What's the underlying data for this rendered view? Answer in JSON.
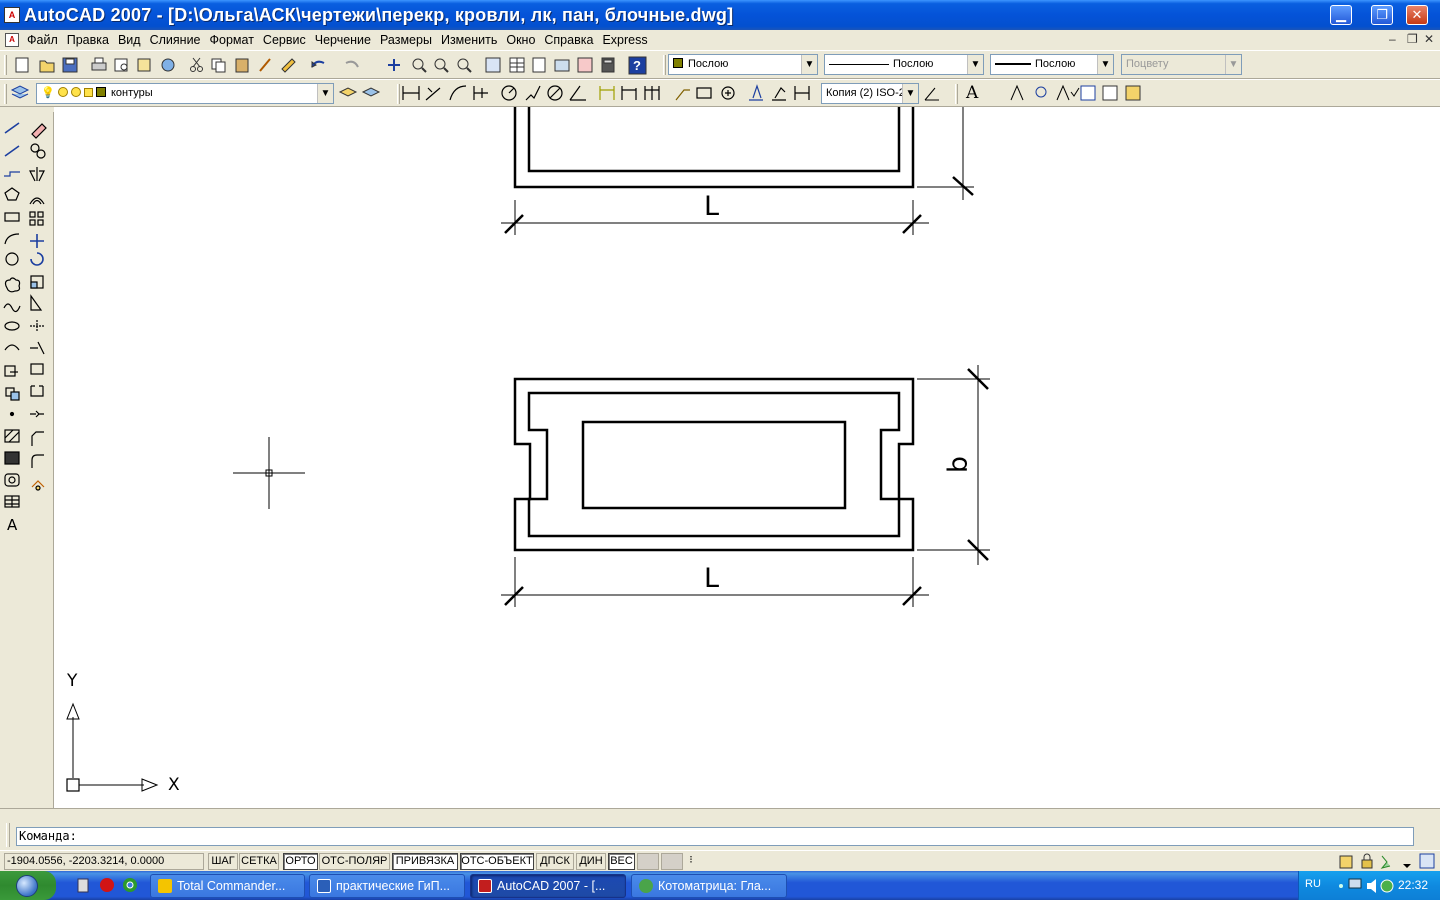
{
  "window": {
    "title": "AutoCAD 2007 - [D:\\Ольга\\АСК\\чертежи\\перекр, кровли, лк, пан, блочные.dwg]",
    "controls": {
      "minimize": "▁",
      "restore": "❐",
      "close": "✕"
    }
  },
  "menu": {
    "items": [
      "Файл",
      "Правка",
      "Вид",
      "Слияние",
      "Формат",
      "Сервис",
      "Черчение",
      "Размеры",
      "Изменить",
      "Окно",
      "Справка",
      "Express"
    ],
    "doc_controls": {
      "minimize": "–",
      "restore": "❐",
      "close": "✕"
    }
  },
  "properties_toolbar": {
    "color": "Послою",
    "linetype": "Послою",
    "lineweight": "Послою",
    "plotstyle": "Поцвету"
  },
  "layers_toolbar": {
    "current_layer": "контуры",
    "dim_style": "Копия (2) ISO-2"
  },
  "text_toolbar": {
    "text_tool_label": "A"
  },
  "drawing": {
    "dim_label_length_top": "L",
    "dim_label_length_bottom": "L",
    "dim_label_width": "b",
    "ucs_y": "Y",
    "ucs_x": "X"
  },
  "command": {
    "prompt": "Команда:"
  },
  "status": {
    "coordinates": "-1904.0556, -2203.3214, 0.0000",
    "buttons": [
      {
        "label": "ШАГ",
        "on": false
      },
      {
        "label": "СЕТКА",
        "on": false
      },
      {
        "label": "ОРТО",
        "on": true
      },
      {
        "label": "ОТС-ПОЛЯР",
        "on": false
      },
      {
        "label": "ПРИВЯЗКА",
        "on": true
      },
      {
        "label": "ОТС-ОБЪЕКТ",
        "on": true
      },
      {
        "label": "ДПСК",
        "on": false
      },
      {
        "label": "ДИН",
        "on": false
      },
      {
        "label": "ВЕС",
        "on": true
      }
    ]
  },
  "taskbar": {
    "tasks": [
      {
        "label": "Total Commander...",
        "active": false,
        "color": "#f4c400"
      },
      {
        "label": "практические ГиП...",
        "active": false,
        "color": "#2b5fb8"
      },
      {
        "label": "AutoCAD 2007 - [...",
        "active": true,
        "color": "#c21e1e"
      },
      {
        "label": "Котоматрица: Гла...",
        "active": false,
        "color": "#4aa44a"
      }
    ],
    "language": "RU",
    "clock": "22:32"
  },
  "colors": {
    "titlebar": "#0453d8",
    "chrome": "#ece9d8",
    "canvas": "#ffffff",
    "taskbar": "#2157d7",
    "tray": "#0f8ae0",
    "layer_swatch": "#808000"
  }
}
